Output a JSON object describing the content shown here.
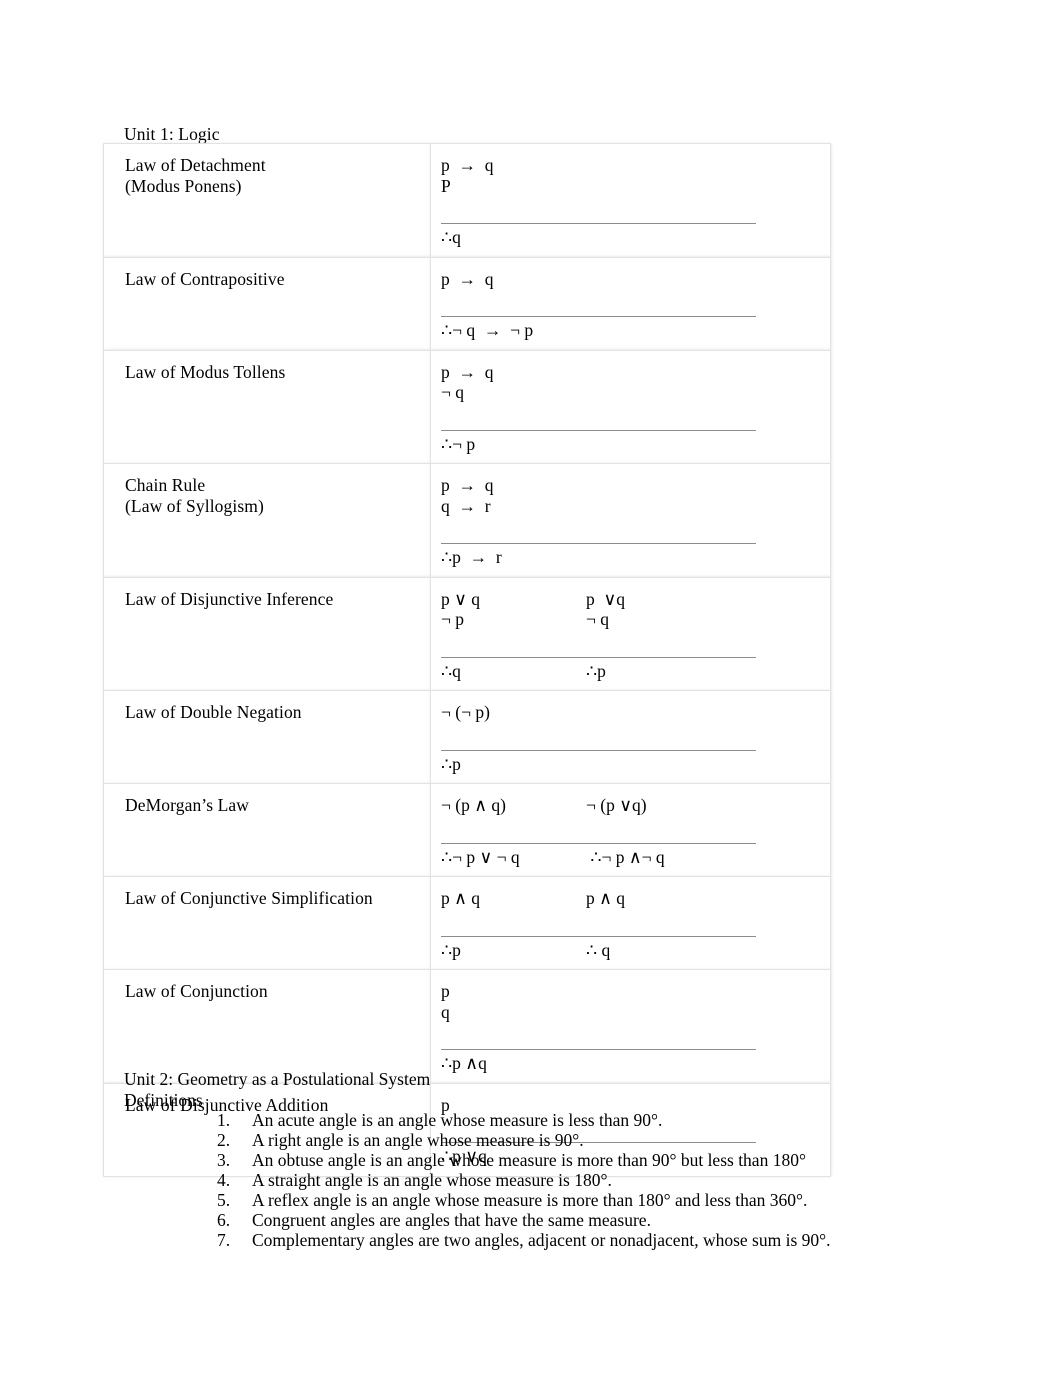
{
  "unit1": {
    "heading": "Unit 1: Logic",
    "rows": [
      {
        "name": "Law of Detachment",
        "name_sub": "(Modus Ponens)",
        "premises": [
          "p  →  q",
          "P"
        ],
        "conclusion": "∴q",
        "alt_premises": [],
        "alt_conclusion": "",
        "pad": "pad-1"
      },
      {
        "name": "Law of Contrapositive",
        "name_sub": "",
        "premises": [
          "p  →  q"
        ],
        "conclusion": "∴¬ q  →  ¬ p",
        "alt_premises": [],
        "alt_conclusion": "",
        "pad": "pad-1"
      },
      {
        "name": "Law of Modus Tollens",
        "name_sub": "",
        "premises": [
          "p  →  q",
          "¬ q"
        ],
        "conclusion": "∴¬ p",
        "alt_premises": [],
        "alt_conclusion": "",
        "pad": "pad-1"
      },
      {
        "name": "Chain Rule",
        "name_sub": "(Law of Syllogism)",
        "premises": [
          "p  →  q",
          "q  →  r"
        ],
        "conclusion": "∴p  →  r",
        "alt_premises": [],
        "alt_conclusion": "",
        "pad": "pad-1"
      },
      {
        "name": "Law of Disjunctive Inference",
        "name_sub": "",
        "premises": [
          "p ∨ q",
          "¬ p"
        ],
        "conclusion": "∴q",
        "alt_premises": [
          "p  ∨q",
          "¬ q"
        ],
        "alt_conclusion": "∴p",
        "pad": "pad-1"
      },
      {
        "name": "Law of Double Negation",
        "name_sub": "",
        "premises": [
          "¬ (¬ p)"
        ],
        "conclusion": "∴p",
        "alt_premises": [],
        "alt_conclusion": "",
        "pad": "pad-1"
      },
      {
        "name": "DeMorgan’s Law",
        "name_sub": "",
        "premises": [
          "¬ (p ∧ q)"
        ],
        "conclusion": "∴¬ p ∨ ¬ q",
        "alt_premises": [
          "¬ (p ∨q)"
        ],
        "alt_conclusion": " ∴¬ p ∧¬ q",
        "pad": "pad-1"
      },
      {
        "name": "Law of Conjunctive Simplification",
        "name_sub": "",
        "premises": [
          "p ∧ q"
        ],
        "conclusion": "∴p",
        "alt_premises": [
          "p ∧ q"
        ],
        "alt_conclusion": "∴ q",
        "pad": "pad-1"
      },
      {
        "name": "Law of Conjunction",
        "name_sub": "",
        "premises": [
          "p",
          "q"
        ],
        "conclusion": "∴p ∧q",
        "alt_premises": [],
        "alt_conclusion": "",
        "pad": "pad-1"
      },
      {
        "name": "Law of Disjunctive Addition",
        "name_sub": "",
        "premises": [
          "p"
        ],
        "conclusion": "∴p ∨q",
        "alt_premises": [],
        "alt_conclusion": "",
        "pad": "pad-1"
      }
    ]
  },
  "unit2": {
    "heading": "Unit 2: Geometry as a Postulational System",
    "subheading": "Definitions",
    "definitions": [
      {
        "num": "1.",
        "text": "An acute angle  is an angle whose measure is less than 90°."
      },
      {
        "num": "2.",
        "text": "A right angle  is an angle whose measure is 90°."
      },
      {
        "num": "3.",
        "text": "An obtuse angle  is an angle whose measure is more than 90° but less than 180°"
      },
      {
        "num": "4.",
        "text": "A straight angle   is an angle whose measure is 180°."
      },
      {
        "num": "5.",
        "text": "A reflex angle  is an angle whose measure is more than 180° and less than 360°."
      },
      {
        "num": "6.",
        "text": "Congruent   angles are angles that have the same measure."
      },
      {
        "num": "7.",
        "text": "Complementary angles   are two angles, adjacent or nonadjacent, whose sum is 90°."
      }
    ]
  }
}
